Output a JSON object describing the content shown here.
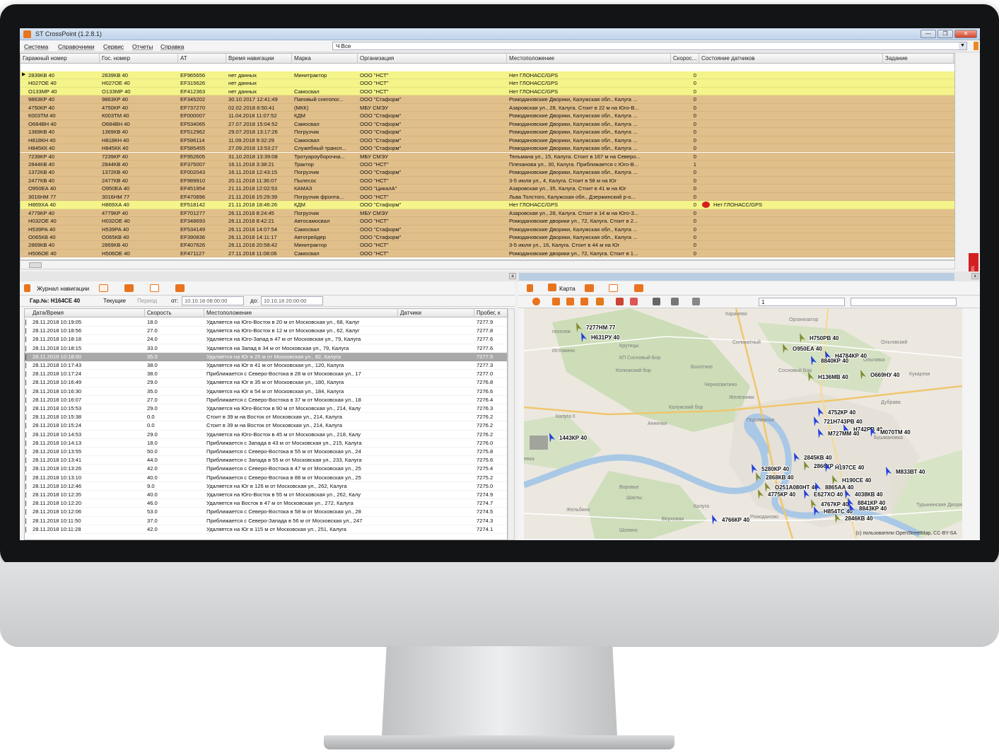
{
  "window": {
    "title": "ST CrossPoint (1.2.8.1)",
    "buttons": [
      "—",
      "❐",
      "✕"
    ]
  },
  "menu": [
    {
      "label": "Система"
    },
    {
      "label": "Справочники"
    },
    {
      "label": "Сервис"
    },
    {
      "label": "Отчеты"
    },
    {
      "label": "Справка"
    }
  ],
  "filter": {
    "value": "Ч Все"
  },
  "vehicle_table": {
    "columns": [
      "Гаражный номер",
      "Гос. номер",
      "AT",
      "Время навигации",
      "Марка",
      "Организация",
      "Местоположение",
      "Скорос...",
      "Состояние датчиков",
      "Задание"
    ],
    "rows": [
      {
        "g": "2839КВ 40",
        "n": "2839КВ 40",
        "at": "EF965656",
        "t": "нет данных",
        "m": "Минитрактор",
        "o": "ООО \"НСТ\"",
        "loc": "Нет ГЛОНАСС/GPS",
        "s": "0",
        "st": "",
        "c": "yellow",
        "mark": "▶"
      },
      {
        "g": "Н027ОЕ 40",
        "n": "Н027ОЕ 40",
        "at": "EF315626",
        "t": "нет данных",
        "m": "",
        "o": "ООО \"НСТ\"",
        "loc": "Нет ГЛОНАСС/GPS",
        "s": "0",
        "st": "",
        "c": "yellow"
      },
      {
        "g": "О133МР 40",
        "n": "О133МР 40",
        "at": "EF412363",
        "t": "нет данных",
        "m": "Самосвал",
        "o": "ООО \"НСТ\"",
        "loc": "Нет ГЛОНАСС/GPS",
        "s": "0",
        "st": "",
        "c": "yellow"
      },
      {
        "g": "9863КР 40",
        "n": "9863КР 40",
        "at": "EF345202",
        "t": "30.10.2017 12:41:49",
        "m": "Паповый снегопог...",
        "o": "ООО \"Стаформ\"",
        "loc": "Ромодановские Дворики, Калужская обл., Калуга ...",
        "s": "0",
        "st": "",
        "c": "tan"
      },
      {
        "g": "4750КР 40",
        "n": "4750КР 40",
        "at": "EF737270",
        "t": "02.02.2018 8:50:41",
        "m": "(МКК)",
        "o": "МБУ СМЭУ",
        "loc": "Азаровская ул., 28, Калуга. Стоит в 22 м на Юго-В...",
        "s": "0",
        "st": "",
        "c": "tan"
      },
      {
        "g": "К003ТМ 40",
        "n": "К003ТМ 40",
        "at": "EF000007",
        "t": "11.04.2018 11:07:52",
        "m": "КДМ",
        "o": "ООО \"Стаформ\"",
        "loc": "Ромодановские Дворики, Калужская обл., Калуга ...",
        "s": "0",
        "st": "",
        "c": "tan"
      },
      {
        "g": "О684ВН 40",
        "n": "О684ВН 40",
        "at": "EF534065",
        "t": "27.07.2018 15:04:52",
        "m": "Самосвал",
        "o": "ООО \"Стаформ\"",
        "loc": "Ромодановские Дворики, Калужская обл., Калуга ...",
        "s": "0",
        "st": "",
        "c": "tan"
      },
      {
        "g": "1369КВ 40",
        "n": "1369КВ 40",
        "at": "EF512962",
        "t": "29.07.2018 13:17:26",
        "m": "Погрузчик",
        "o": "ООО \"Стаформ\"",
        "loc": "Ромодановские Дворики, Калужская обл., Калуга ...",
        "s": "0",
        "st": "",
        "c": "tan"
      },
      {
        "g": "Н818КН 40",
        "n": "Н818КН 40",
        "at": "EF596114",
        "t": "11.09.2018 9:32:29",
        "m": "Самосвал",
        "o": "ООО \"Стаформ\"",
        "loc": "Ромодановские Дворики, Калужская обл., Калуга ...",
        "s": "0",
        "st": "",
        "c": "tan"
      },
      {
        "g": "Н845КК 40",
        "n": "Н845КК 40",
        "at": "EF585455",
        "t": "27.09.2018 13:53:27",
        "m": "Служебный трансп...",
        "o": "ООО \"Стаформ\"",
        "loc": "Ромодановские Дворики, Калужская обл., Калуга ...",
        "s": "0",
        "st": "",
        "c": "tan"
      },
      {
        "g": "7239КР 40",
        "n": "7239КР 40",
        "at": "EF952605",
        "t": "31.10.2018 13:39:08",
        "m": "Тротуароуборочна...",
        "o": "МБУ СМЭУ",
        "loc": "Тельмана ул., 15, Калуга. Стоит в 167 м на Северо...",
        "s": "0",
        "st": "",
        "c": "tan"
      },
      {
        "g": "2844КВ 40",
        "n": "2844КВ 40",
        "at": "EF375007",
        "t": "16.11.2018 3:38:21",
        "m": "Трактор",
        "o": "ООО \"НСТ\"",
        "loc": "Плеханова ул., 30, Калуга. Приближается с Юго-В...",
        "s": "1",
        "st": "",
        "c": "tan"
      },
      {
        "g": "1372КВ 40",
        "n": "1372КВ 40",
        "at": "EF002043",
        "t": "16.11.2018 12:43:15",
        "m": "Погрузчик",
        "o": "ООО \"Стаформ\"",
        "loc": "Ромодановские Дворики, Калужская обл., Калуга ...",
        "s": "0",
        "st": "",
        "c": "tan"
      },
      {
        "g": "2477КВ 40",
        "n": "2477КВ 40",
        "at": "EF989910",
        "t": "20.11.2018 11:36:07",
        "m": "Пылесос",
        "o": "ООО \"НСТ\"",
        "loc": "3-5 июля ул., 4, Калуга. Стоит в 58 м на Юг",
        "s": "0",
        "st": "",
        "c": "tan"
      },
      {
        "g": "О950ЕА 40",
        "n": "О950ЕА 40",
        "at": "EF451954",
        "t": "21.11.2018 12:02:53",
        "m": "КАМАЗ",
        "o": "ООО \"ЦикалА\"",
        "loc": "Азаровская ул., 35, Калуга. Стоит в 41 м на Юг",
        "s": "0",
        "st": "",
        "c": "tan"
      },
      {
        "g": "3016НМ 77",
        "n": "3016НМ 77",
        "at": "EF470896",
        "t": "21.11.2018 15:29:39",
        "m": "Погрузчик фронта...",
        "o": "ООО \"НСТ\"",
        "loc": "Льва Толстого, Калужская обл., Дзержинский р-о...",
        "s": "0",
        "st": "",
        "c": "tan"
      },
      {
        "g": "Н869ХА 40",
        "n": "Н869ХА 40",
        "at": "EF518142",
        "t": "21.11.2018 18:46:26",
        "m": "КДМ",
        "o": "ООО \"Стаформ\"",
        "loc": "Нет ГЛОНАСС/GPS",
        "s": "0",
        "st": "Нет ГЛОНАСС/GPS",
        "c": "yellow"
      },
      {
        "g": "4779КР 40",
        "n": "4779КР 40",
        "at": "EF701277",
        "t": "26.11.2018 8:24:45",
        "m": "Погрузчик",
        "o": "МБУ СМЭУ",
        "loc": "Азаровская ул., 28, Калуга. Стоит в 14 м на Юго-З...",
        "s": "0",
        "st": "",
        "c": "tan"
      },
      {
        "g": "Н032ОЕ 40",
        "n": "Н032ОЕ 40",
        "at": "EF348693",
        "t": "26.11.2018 8:42:21",
        "m": "Автосамосвал",
        "o": "ООО \"НСТ\"",
        "loc": "Ромодановские дворики ул., 72, Калуга. Стоит в 2...",
        "s": "0",
        "st": "",
        "c": "tan"
      },
      {
        "g": "Н539РА 40",
        "n": "Н539РА 40",
        "at": "EF534149",
        "t": "26.11.2018 14:07:54",
        "m": "Самосвал",
        "o": "ООО \"Стаформ\"",
        "loc": "Ромодановские Дворики, Калужская обл., Калуга ...",
        "s": "0",
        "st": "",
        "c": "tan"
      },
      {
        "g": "О065КВ 40",
        "n": "О065КВ 40",
        "at": "EF390836",
        "t": "26.11.2018 14:11:17",
        "m": "Автогрейдер",
        "o": "ООО \"Стаформ\"",
        "loc": "Ромодановские Дворики, Калужская обл., Калуга ...",
        "s": "0",
        "st": "",
        "c": "tan"
      },
      {
        "g": "2869КВ 40",
        "n": "2869КВ 40",
        "at": "EF407626",
        "t": "26.11.2018 20:58:42",
        "m": "Минитрактор",
        "o": "ООО \"НСТ\"",
        "loc": "3-5 июля ул., 16, Калуга. Стоит в 44 м на Юг",
        "s": "0",
        "st": "",
        "c": "tan"
      },
      {
        "g": "Н506ОЕ 40",
        "n": "Н506ОЕ 40",
        "at": "EF471127",
        "t": "27.11.2018 11:08:06",
        "m": "Самосвал",
        "o": "ООО \"НСТ\"",
        "loc": "Ромодановские дворики ул., 72, Калуга. Стоит в 1...",
        "s": "0",
        "st": "",
        "c": "tan"
      }
    ]
  },
  "colors": {
    "yellow_row": "#f4f48a",
    "tan_row": "#e1bf8a",
    "selected_row": "#a9a9a9",
    "accent": "#e8741f",
    "alert_red": "#d31f1f"
  },
  "side_tab_label": "Группы: 001",
  "nav_panel": {
    "tab_label": "Журнал навигации",
    "garage_label": "Гар.№: Н164СЕ 40",
    "current_label": "Текущие",
    "period_label": "Период",
    "from_label": "от:",
    "from_value": "10.10.18 08:00:00",
    "to_label": "до:",
    "to_value": "10.10.18 20:00:00",
    "columns": [
      "Дата/Время",
      "Скорость",
      "Местоположение",
      "Датчики",
      "Пробег, к"
    ],
    "rows": [
      {
        "dt": "28.11.2018 10:19:05",
        "sp": "18.0",
        "loc": "Удаляется на Юго-Восток в 20 м от Московская ул., 68, Калуг",
        "km": "7277.9"
      },
      {
        "dt": "28.11.2018 10:18:56",
        "sp": "27.0",
        "loc": "Удаляется на Юго-Восток в 12 м от Московская ул., 62, Калуг",
        "km": "7277.8"
      },
      {
        "dt": "28.11.2018 10:18:18",
        "sp": "24.0",
        "loc": "Удаляется на Юго-Запад в 47 м от Московская ул., 79, Калуга",
        "km": "7277.6"
      },
      {
        "dt": "28.11.2018 10:18:15",
        "sp": "33.0",
        "loc": "Удаляется на Запад в 34 м от Московская ул., 79, Калуга",
        "km": "7277.6"
      },
      {
        "dt": "28.11.2018 10:18:00",
        "sp": "35.0",
        "loc": "Удаляется на Юг в 25 м от Московская ул., 82, Калуга",
        "km": "7277.5",
        "sel": true
      },
      {
        "dt": "28.11.2018 10:17:43",
        "sp": "38.0",
        "loc": "Удаляется на Юг в 41 м от Московская ул., 120, Калуга",
        "km": "7277.3"
      },
      {
        "dt": "28.11.2018 10:17:24",
        "sp": "38.0",
        "loc": "Приближается с Северо-Востока в 28 м от Московская ул., 17",
        "km": "7277.0"
      },
      {
        "dt": "28.11.2018 10:16:49",
        "sp": "29.0",
        "loc": "Удаляется на Юг в 35 м от Московская ул., 180, Калуга",
        "km": "7276.8"
      },
      {
        "dt": "28.11.2018 10:16:30",
        "sp": "35.0",
        "loc": "Удаляется на Юг в 54 м от Московская ул., 184, Калуга",
        "km": "7276.6"
      },
      {
        "dt": "28.11.2018 10:16:07",
        "sp": "27.0",
        "loc": "Приближается с Северо-Востока в 37 м от Московская ул., 18",
        "km": "7276.4"
      },
      {
        "dt": "28.11.2018 10:15:53",
        "sp": "29.0",
        "loc": "Удаляется на Юго-Восток в 90 м от Московская ул., 214, Калу",
        "km": "7276.3"
      },
      {
        "dt": "28.11.2018 10:15:38",
        "sp": "0.0",
        "loc": "Стоит в 39 м на Восток от Московская ул., 214, Калуга",
        "km": "7276.2"
      },
      {
        "dt": "28.11.2018 10:15:24",
        "sp": "0.0",
        "loc": "Стоит в 39 м на Восток от Московская ул., 214, Калуга",
        "km": "7276.2"
      },
      {
        "dt": "28.11.2018 10:14:53",
        "sp": "29.0",
        "loc": "Удаляется на Юго-Восток в 45 м от Московская ул., 218, Калу",
        "km": "7276.2"
      },
      {
        "dt": "28.11.2018 10:14:13",
        "sp": "18.0",
        "loc": "Приближается с Запада в 43 м от Московская ул., 215, Калуга",
        "km": "7276.0"
      },
      {
        "dt": "28.11.2018 10:13:55",
        "sp": "50.0",
        "loc": "Приближается с Северо-Востока в 55 м от Московская ул., 24",
        "km": "7275.8"
      },
      {
        "dt": "28.11.2018 10:13:41",
        "sp": "44.0",
        "loc": "Приближается с Запада в 55 м от Московская ул., 233, Калуга",
        "km": "7275.6"
      },
      {
        "dt": "28.11.2018 10:13:26",
        "sp": "42.0",
        "loc": "Приближается с Северо-Востока в 47 м от Московская ул., 25",
        "km": "7275.4"
      },
      {
        "dt": "28.11.2018 10:13:10",
        "sp": "40.0",
        "loc": "Приближается с Северо-Востока в 88 м от Московская ул., 25",
        "km": "7275.2"
      },
      {
        "dt": "28.11.2018 10:12:46",
        "sp": "9.0",
        "loc": "Удаляется на Юг в 126 м от Московская ул., 262, Калуга",
        "km": "7275.0"
      },
      {
        "dt": "28.11.2018 10:12:35",
        "sp": "40.0",
        "loc": "Удаляется на Юго-Восток в 55 м от Московская ул., 262, Калу",
        "km": "7274.9"
      },
      {
        "dt": "28.11.2018 10:12:20",
        "sp": "46.0",
        "loc": "Удаляется на Восток в 47 м от Московская ул., 272, Калуга",
        "km": "7274.7"
      },
      {
        "dt": "28.11.2018 10:12:06",
        "sp": "53.0",
        "loc": "Приближается с Северо-Востока в 58 м от Московская ул., 28",
        "km": "7274.5"
      },
      {
        "dt": "28.11.2018 10:11:50",
        "sp": "37.0",
        "loc": "Приближается с Северо-Запада в 56 м от Московская ул., 247",
        "km": "7274.3"
      },
      {
        "dt": "28.11.2018 10:11:28",
        "sp": "42.0",
        "loc": "Удаляется на Юг в 115 м от Московская ул., 251, Калуга",
        "km": "7274.1"
      }
    ]
  },
  "map_panel": {
    "tab_label": "Карта",
    "combo_value": "1",
    "attribution": "(c) пользователи OpenStreetMap, CC-BY-SA",
    "place_labels": [
      {
        "text": "Карачево"
      },
      {
        "text": "Организатор"
      },
      {
        "text": "Силикатный"
      },
      {
        "text": "Ольговский"
      },
      {
        "text": "поселок"
      },
      {
        "text": "Истомино"
      },
      {
        "text": "Крутицы"
      },
      {
        "text": "КП Сосновый Бор"
      },
      {
        "text": "Колюжский бор"
      },
      {
        "text": "Болотное"
      },
      {
        "text": "Сосновый Бор"
      },
      {
        "text": "Ольговка"
      },
      {
        "text": "Черносвитино"
      },
      {
        "text": "Железники"
      },
      {
        "text": "Кукареки"
      },
      {
        "text": "Дубрава"
      },
      {
        "text": "Калуга II"
      },
      {
        "text": "Калужский бор"
      },
      {
        "text": "Анненки"
      },
      {
        "text": "Подзавалье"
      },
      {
        "text": "Бушмановка"
      },
      {
        "text": "Воровье"
      },
      {
        "text": "Шахты"
      },
      {
        "text": "Жельбино"
      },
      {
        "text": "Верховая"
      },
      {
        "text": "Ромоданово"
      },
      {
        "text": "Шопино"
      },
      {
        "text": "Турынинские Дворики"
      },
      {
        "text": "евка"
      },
      {
        "text": "Калуга"
      }
    ],
    "vehicle_labels": [
      {
        "text": "7277НМ 77",
        "dir": "green"
      },
      {
        "text": "Н631РУ 40",
        "dir": "blue"
      },
      {
        "text": "Н750РВ 40",
        "dir": "green"
      },
      {
        "text": "О950ЕА 40",
        "dir": "green"
      },
      {
        "text": "Н4784КР 40",
        "dir": "blue"
      },
      {
        "text": "8840КР 40",
        "dir": "blue"
      },
      {
        "text": "Н136МВ 40",
        "dir": "green"
      },
      {
        "text": "О669НУ 40",
        "dir": "green"
      },
      {
        "text": "4752КР 40",
        "dir": "blue"
      },
      {
        "text": "721Н743РВ 40",
        "dir": "blue"
      },
      {
        "text": "Н742РВ 40",
        "dir": "blue"
      },
      {
        "text": "М727ММ 40",
        "dir": "blue"
      },
      {
        "text": "М070ТМ 40",
        "dir": "blue"
      },
      {
        "text": "1443КР 40",
        "dir": "blue"
      },
      {
        "text": "2845КВ 40",
        "dir": "blue"
      },
      {
        "text": "2866КР 40",
        "dir": "green"
      },
      {
        "text": "5280КР 40",
        "dir": "blue"
      },
      {
        "text": "Н197СЕ 40",
        "dir": "blue"
      },
      {
        "text": "М833ВТ 40",
        "dir": "blue"
      },
      {
        "text": "Н190СЕ 40",
        "dir": "green"
      },
      {
        "text": "2868КВ 40",
        "dir": "green"
      },
      {
        "text": "О251А080НТ 40",
        "dir": "green"
      },
      {
        "text": "8865АА 40",
        "dir": "blue"
      },
      {
        "text": "4775КР 40",
        "dir": "green"
      },
      {
        "text": "Е627ХО 40",
        "dir": "blue"
      },
      {
        "text": "4038КВ 40",
        "dir": "blue"
      },
      {
        "text": "4767КР 40",
        "dir": "green"
      },
      {
        "text": "8841КР 40",
        "dir": "blue"
      },
      {
        "text": "Н854ТС 40",
        "dir": "blue"
      },
      {
        "text": "8843КР 40",
        "dir": "blue"
      },
      {
        "text": "2846КВ 40",
        "dir": "green"
      },
      {
        "text": "4766КР 40",
        "dir": "blue"
      }
    ]
  }
}
